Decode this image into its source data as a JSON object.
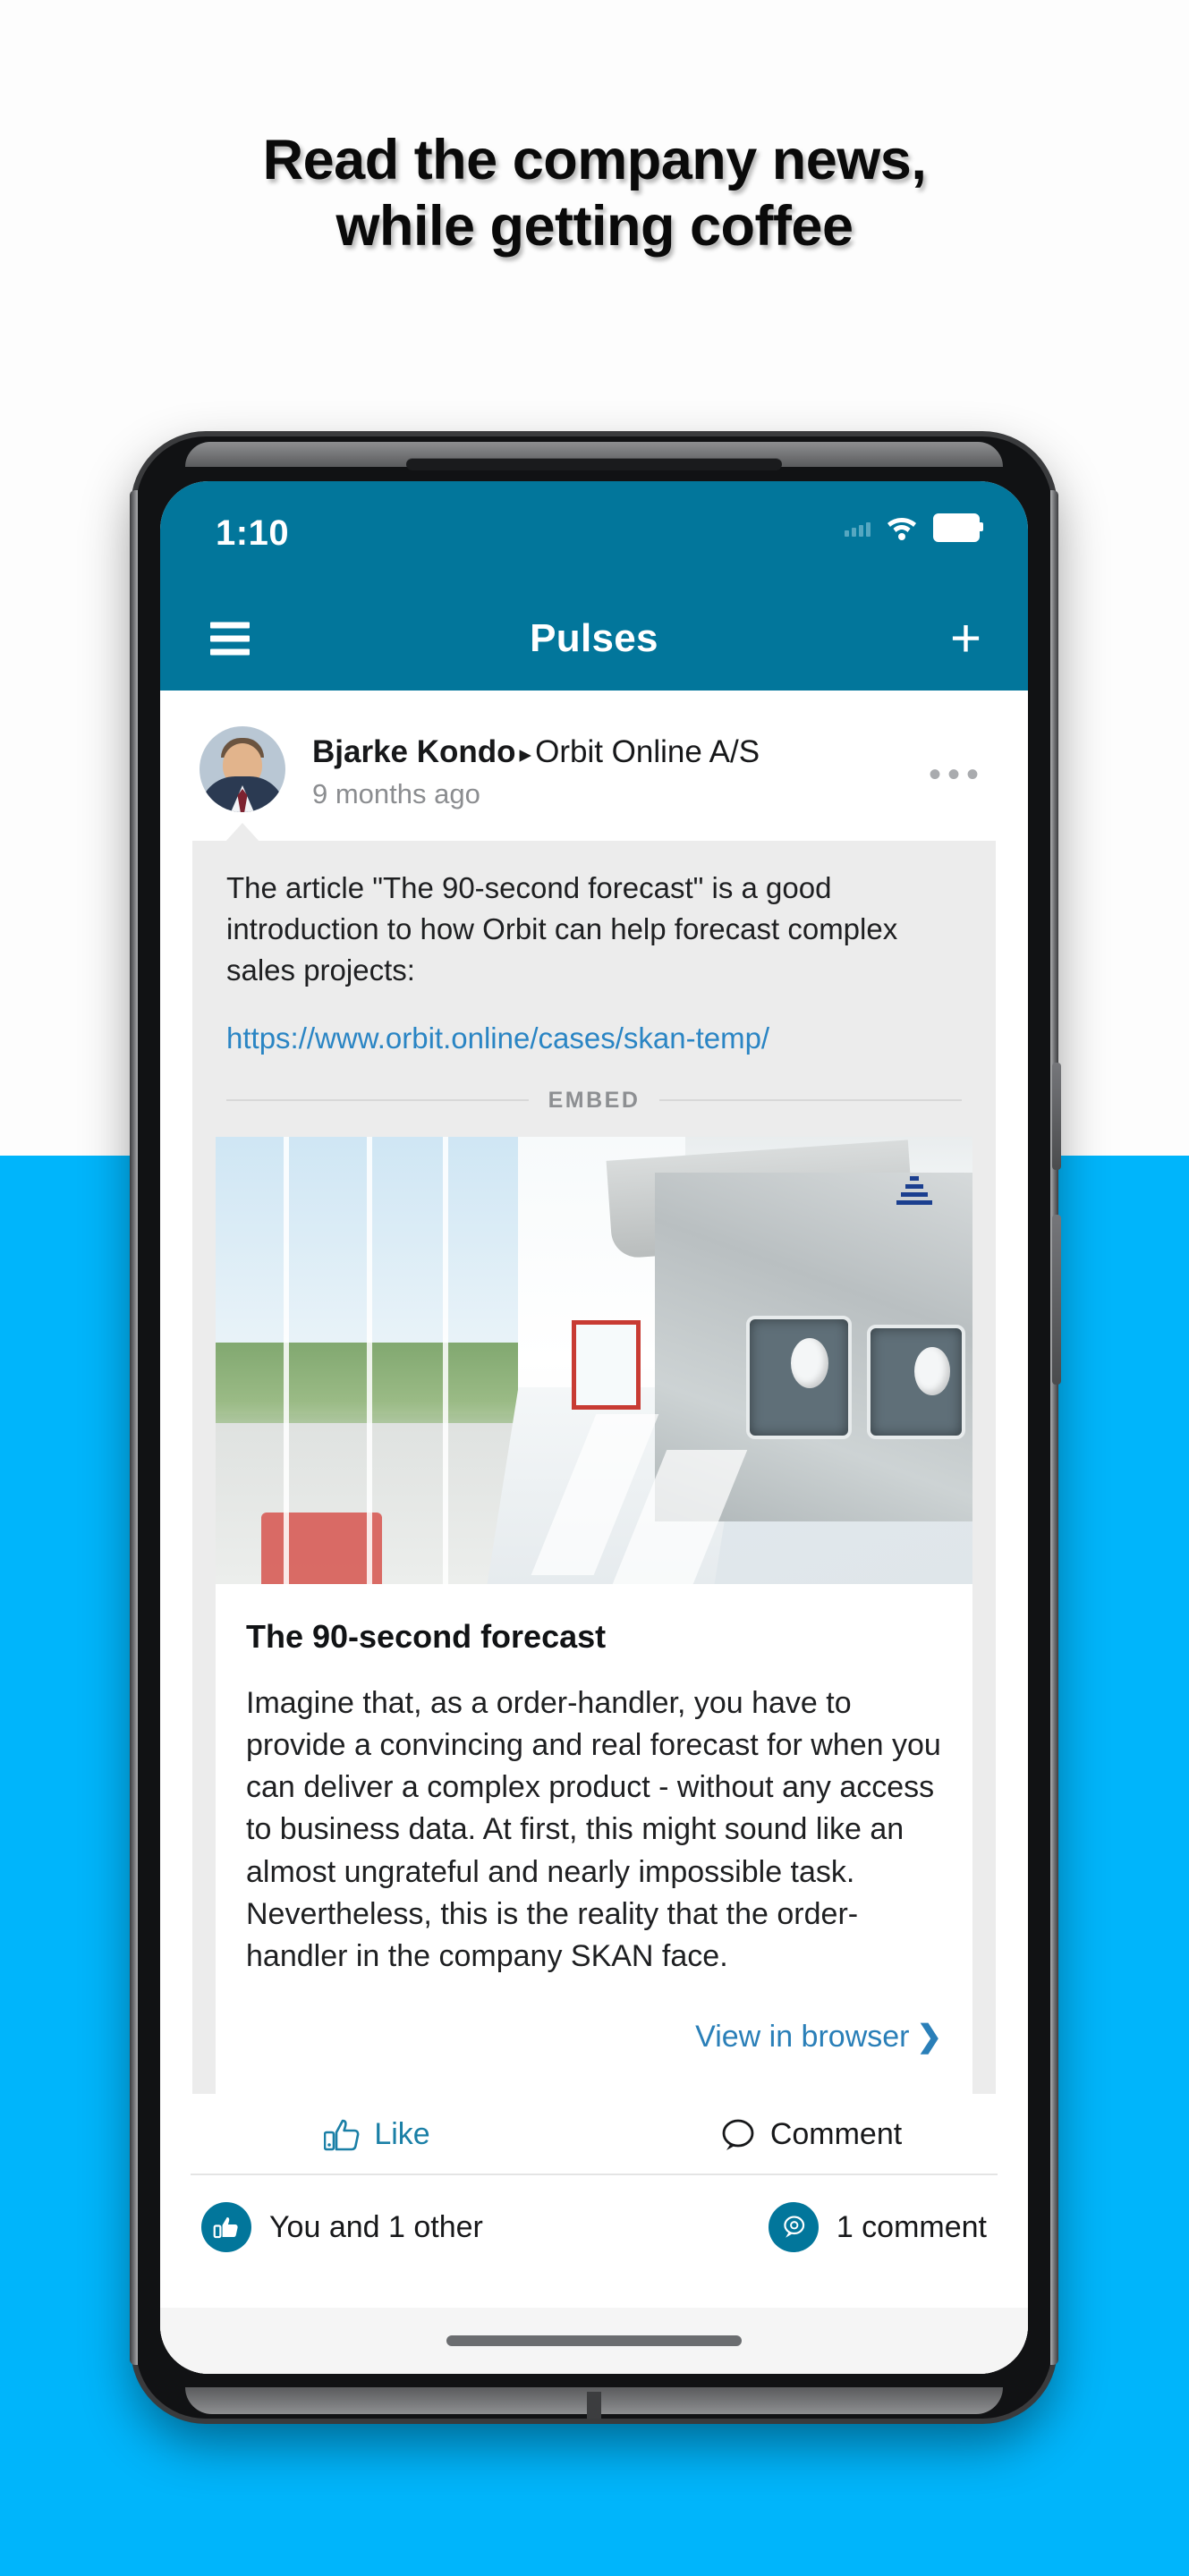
{
  "promo": {
    "headline_line1": "Read the company news,",
    "headline_line2": "while getting coffee",
    "bg_top_color": "#fdfdfd",
    "bg_bottom_color": "#00b5fb"
  },
  "status_bar": {
    "time": "1:10",
    "signal_icon": "signal-bars-icon",
    "wifi_icon": "wifi-icon",
    "battery_icon": "battery-full-icon"
  },
  "app_bar": {
    "menu_icon": "hamburger-menu-icon",
    "title": "Pulses",
    "add_label": "+",
    "bg_color": "#02769b"
  },
  "post": {
    "author": "Bjarke Kondo",
    "separator": "▸",
    "group": "Orbit Online A/S",
    "timestamp": "9 months ago",
    "more_label": "•••",
    "body": "The article \"The 90-second forecast\" is a good introduction to how Orbit can help forecast complex sales projects:",
    "link": "https://www.orbit.online/cases/skan-temp/",
    "link_color": "#2a85c4",
    "embed_label": "EMBED"
  },
  "embed": {
    "image_alt": "cleanroom-corridor-photo",
    "title": "The 90-second forecast",
    "text": "Imagine that, as a order-handler, you have to provide a convincing and real forecast for when you can deliver a complex product - without any access to business data. At first, this might sound like an almost ungrateful and nearly impossible task. Nevertheless, this is the reality that the order-handler in the company SKAN face.",
    "view_browser_label": "View in browser",
    "view_browser_chevron": "❯",
    "link_color": "#2a7fb8"
  },
  "actions": {
    "like_label": "Like",
    "like_icon": "thumbs-up-icon",
    "like_color": "#1a7fa6",
    "comment_label": "Comment",
    "comment_icon": "comment-bubble-icon",
    "comment_color": "#17181a"
  },
  "stats": {
    "likes_label": "You and 1 other",
    "likes_icon": "thumbs-up-badge-icon",
    "comments_label": "1 comment",
    "comments_icon": "comment-badge-icon",
    "badge_color": "#02769b"
  },
  "system": {
    "home_indicator": "home-indicator-bar"
  }
}
